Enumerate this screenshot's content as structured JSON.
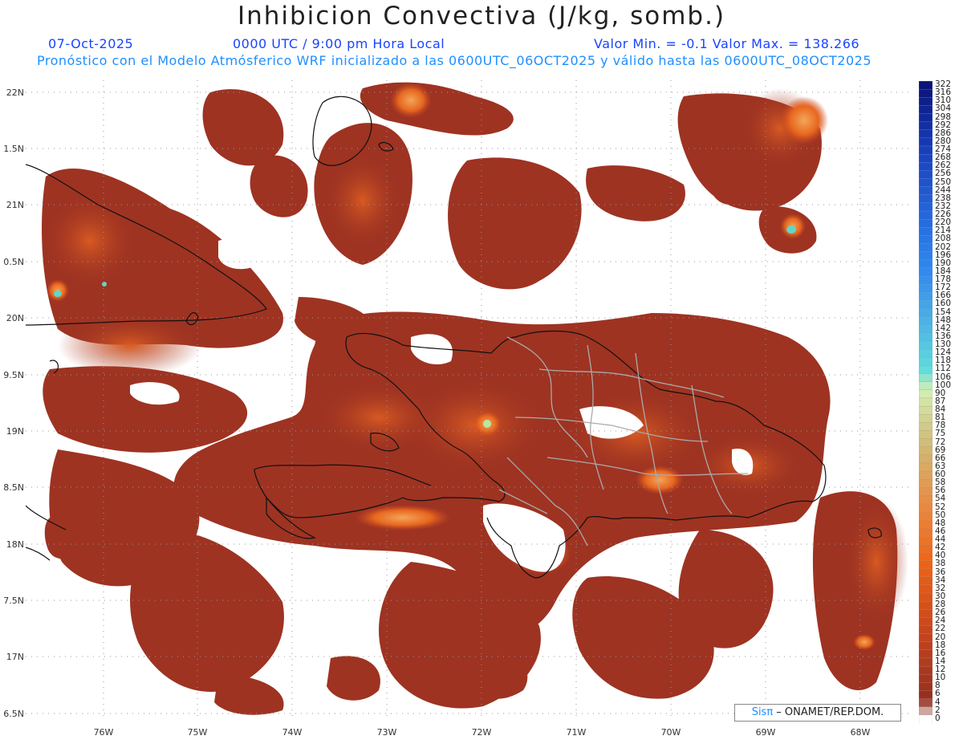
{
  "title": "Inhibicion Convectiva (J/kg, somb.)",
  "date": "07-Oct-2025",
  "time": "0000 UTC / 9:00 pm Hora Local",
  "minmax": "Valor Min. = -0.1  Valor Max. = 138.266",
  "subtitle": "Pronóstico con el Modelo Atmósferico WRF inicializado a las 0600UTC_06OCT2025 y válido hasta las  0600UTC_08OCT2025",
  "credit": {
    "prefix": "Sis",
    "pi": "π",
    "suffix": " – ONAMET/REP.DOM."
  },
  "lat_labels": [
    "22N",
    "1.5N",
    "21N",
    "0.5N",
    "20N",
    "9.5N",
    "19N",
    "8.5N",
    "18N",
    "7.5N",
    "17N",
    "6.5N"
  ],
  "lon_labels": [
    "76W",
    "75W",
    "74W",
    "73W",
    "72W",
    "71W",
    "70W",
    "69W",
    "68W"
  ],
  "legend_labels": [
    "322",
    "316",
    "310",
    "304",
    "298",
    "292",
    "286",
    "280",
    "274",
    "268",
    "262",
    "256",
    "250",
    "244",
    "238",
    "232",
    "226",
    "220",
    "214",
    "208",
    "202",
    "196",
    "190",
    "184",
    "178",
    "172",
    "166",
    "160",
    "154",
    "148",
    "142",
    "136",
    "130",
    "124",
    "118",
    "112",
    "106",
    "100",
    "90",
    "87",
    "84",
    "81",
    "78",
    "75",
    "72",
    "69",
    "66",
    "63",
    "60",
    "58",
    "56",
    "54",
    "52",
    "50",
    "48",
    "46",
    "44",
    "42",
    "40",
    "38",
    "36",
    "34",
    "32",
    "30",
    "28",
    "26",
    "24",
    "22",
    "20",
    "18",
    "16",
    "14",
    "12",
    "10",
    "8",
    "6",
    "4",
    "2",
    "0"
  ],
  "colors": {
    "field": "#9e3322",
    "field_mid": "#c84a22",
    "field_hot": "#e8661e",
    "field_peak": "#f2a65a",
    "pale_green": "#b7e8a0",
    "teal": "#5ed8c8",
    "coast": "#111111",
    "border": "#aaaaaa"
  }
}
